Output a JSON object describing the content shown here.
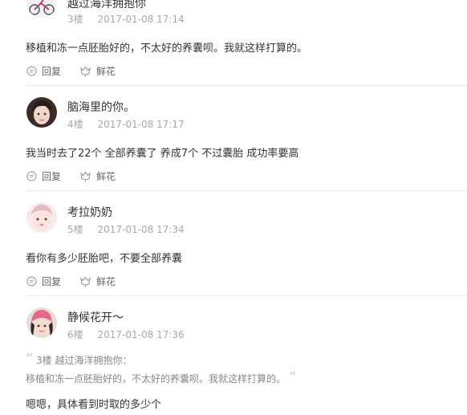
{
  "actions": {
    "reply_label": "回复",
    "flower_label": "鲜花"
  },
  "posts": [
    {
      "username": "越过海洋拥抱你",
      "floor": "3楼",
      "timestamp": "2017-01-08 17:14",
      "content": "移植和冻一点胚胎好的，不太好的养囊呗。我就这样打算的。"
    },
    {
      "username": "脑海里的你。",
      "floor": "4楼",
      "timestamp": "2017-01-08 17:17",
      "content": "我当时去了22个 全部养囊了 养成7个 不过囊胎 成功率要高"
    },
    {
      "username": "考拉奶奶",
      "floor": "5楼",
      "timestamp": "2017-01-08 17:34",
      "content": "看你有多少胚胎吧，不要全部养囊"
    },
    {
      "username": "静候花开～",
      "floor": "6楼",
      "timestamp": "2017-01-08 17:36",
      "quote_header": "3楼 越过海洋拥抱你：",
      "quote_text": "移植和冻一点胚胎好的，不太好的养囊呗。我就这样打算的。",
      "content": "嗯嗯，具体看到时取的多少个"
    }
  ]
}
